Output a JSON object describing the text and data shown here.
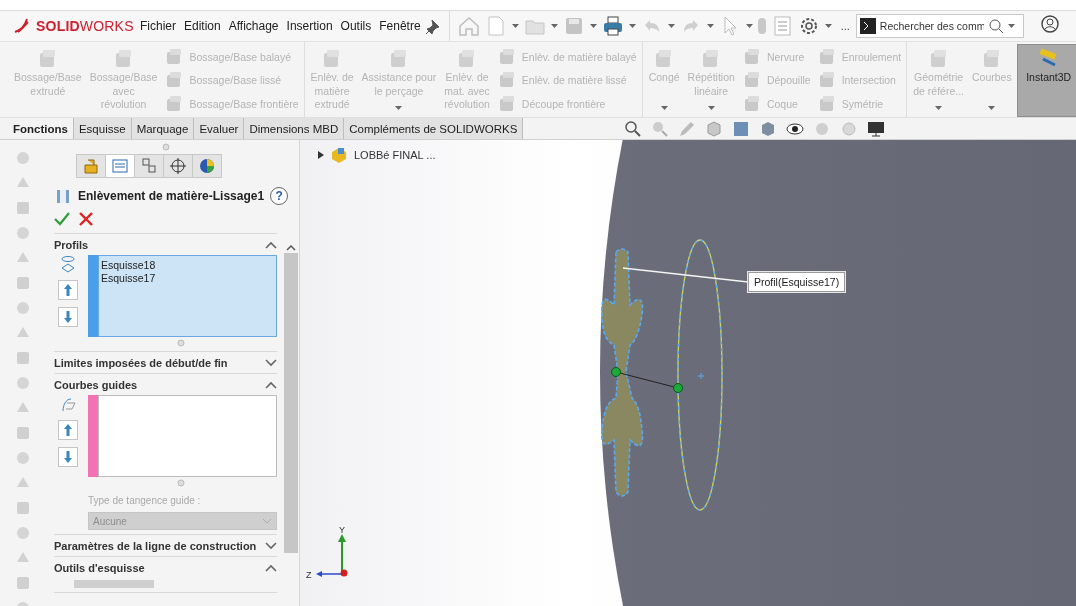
{
  "app": {
    "logo": "**SOLID**WORKS"
  },
  "menu": [
    "Fichier",
    "Edition",
    "Affichage",
    "Insertion",
    "Outils",
    "Fenêtre"
  ],
  "quick_more": "...",
  "search": {
    "placeholder": "Rechercher des comm"
  },
  "ribbon": [
    {
      "columns": [
        {
          "kind": "large",
          "label": "Bossage/Base\nextrudé",
          "disabled": true,
          "selected": false,
          "dropdown": false
        },
        {
          "kind": "large",
          "label": "Bossage/Base\navec\nrévolution",
          "disabled": true,
          "selected": false,
          "dropdown": false
        },
        {
          "kind": "stack",
          "items": [
            {
              "label": "Bossage/Base balayé",
              "disabled": true
            },
            {
              "label": "Bossage/Base lissé",
              "disabled": true
            },
            {
              "label": "Bossage/Base frontière",
              "disabled": true
            }
          ]
        }
      ]
    },
    {
      "columns": [
        {
          "kind": "large",
          "label": "Enlèv. de\nmatière\nextrudé",
          "disabled": true,
          "selected": false,
          "dropdown": false
        },
        {
          "kind": "large",
          "label": "Assistance pour\nle perçage",
          "disabled": true,
          "selected": false,
          "dropdown": true
        },
        {
          "kind": "large",
          "label": "Enlèv. de\nmat. avec\nrévolution",
          "disabled": true,
          "selected": false,
          "dropdown": false
        },
        {
          "kind": "stack",
          "items": [
            {
              "label": "Enlèv. de matière balayé",
              "disabled": true
            },
            {
              "label": "Enlèv. de matière lissé",
              "disabled": true
            },
            {
              "label": "Découpe frontière",
              "disabled": true
            }
          ]
        }
      ]
    },
    {
      "columns": [
        {
          "kind": "large",
          "label": "Congé",
          "disabled": true,
          "selected": false,
          "dropdown": true
        },
        {
          "kind": "large",
          "label": "Répétition\nlinéaire",
          "disabled": true,
          "selected": false,
          "dropdown": true
        },
        {
          "kind": "stack",
          "items": [
            {
              "label": "Nervure",
              "disabled": true
            },
            {
              "label": "Dépouille",
              "disabled": true
            },
            {
              "label": "Coque",
              "disabled": true
            }
          ]
        },
        {
          "kind": "stack",
          "items": [
            {
              "label": "Enroulement",
              "disabled": true
            },
            {
              "label": "Intersection",
              "disabled": true
            },
            {
              "label": "Symétrie",
              "disabled": true
            }
          ]
        }
      ]
    },
    {
      "columns": [
        {
          "kind": "large",
          "label": "Géométrie\nde référe...",
          "disabled": true,
          "selected": false,
          "dropdown": true
        },
        {
          "kind": "large",
          "label": "Courbes",
          "disabled": true,
          "selected": false,
          "dropdown": true
        },
        {
          "kind": "large",
          "label": "Instant3D",
          "disabled": false,
          "selected": true,
          "dropdown": false
        }
      ]
    }
  ],
  "tabs": [
    {
      "label": "Fonctions",
      "selected": true
    },
    {
      "label": "Esquisse",
      "selected": false
    },
    {
      "label": "Marquage",
      "selected": false
    },
    {
      "label": "Evaluer",
      "selected": false
    },
    {
      "label": "Dimensions MBD",
      "selected": false
    },
    {
      "label": "Compléments de SOLIDWORKS",
      "selected": false
    }
  ],
  "panel": {
    "tabs": [
      {
        "selected": false
      },
      {
        "selected": true
      },
      {
        "selected": false
      },
      {
        "selected": false
      },
      {
        "selected": false
      }
    ],
    "title": "Enlèvement de matière-Lissage1",
    "help": "?",
    "sections": [
      {
        "title": "Profils",
        "expanded": true,
        "list": {
          "items": [
            "Esquisse18",
            "Esquisse17"
          ],
          "color": "#4a9eea",
          "active": true
        }
      },
      {
        "title": "Limites imposées de début/de fin",
        "expanded": false
      },
      {
        "title": "Courbes guides",
        "expanded": true,
        "list": {
          "color": "#f273b4",
          "active": false
        },
        "tangent": {
          "label": "Type de tangence guide :",
          "value": "Aucune",
          "disabled": true
        }
      },
      {
        "title": "Paramètres de la ligne de construction",
        "expanded": false
      },
      {
        "title": "Outils d'esquisse",
        "expanded": true
      }
    ]
  },
  "viewport": {
    "tree": {
      "label": "LOBBé FINAL ...",
      "expanded": false
    },
    "callout": "Profil(Esquisse17)",
    "axes": [
      "Y",
      "Z"
    ]
  }
}
